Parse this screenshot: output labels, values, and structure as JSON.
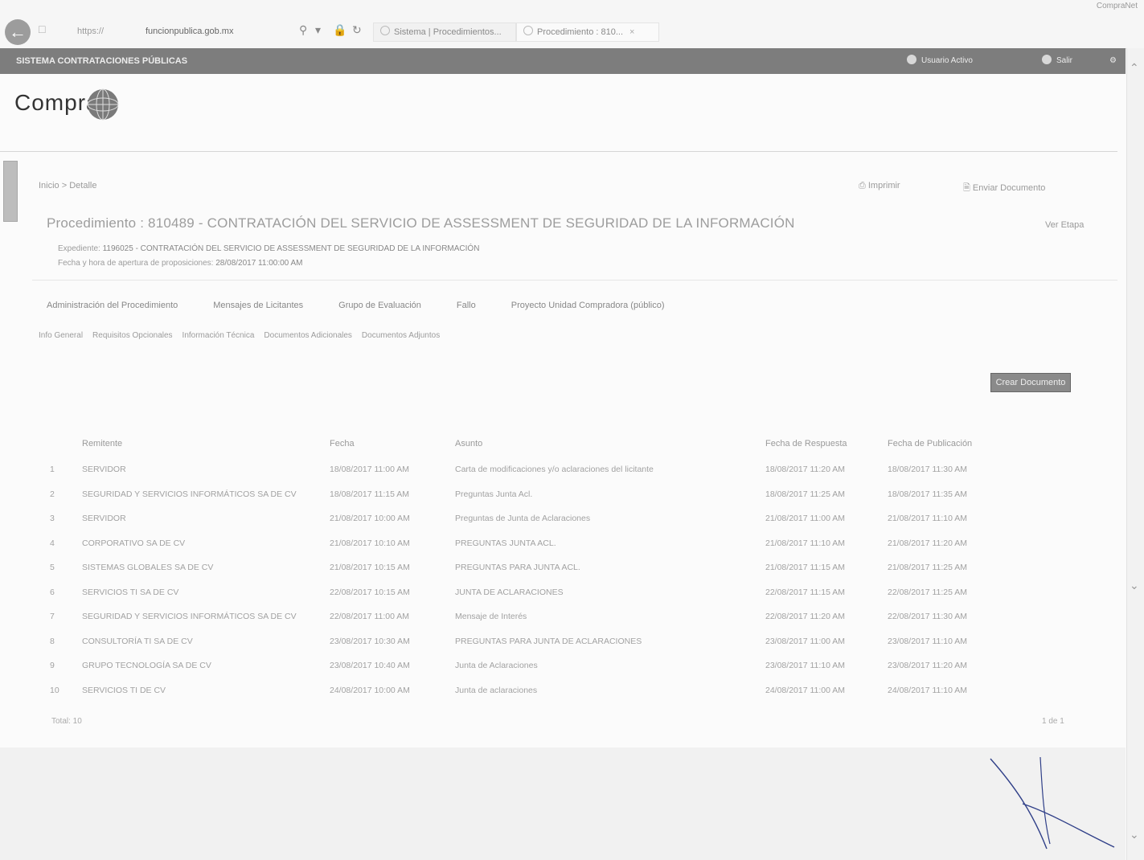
{
  "browser": {
    "address_prefix": "https://",
    "address_domain": "funcionpublica.gob.mx",
    "tabs": [
      {
        "label": "Sistema | Procedimientos..."
      },
      {
        "label": "Procedimiento : 810..."
      }
    ],
    "top_right_text": "CompraNet"
  },
  "appbar": {
    "title": "SISTEMA CONTRATACIONES PÚBLICAS",
    "user_label": "Usuario Activo",
    "menu_label": "Salir"
  },
  "logo": {
    "text": "Compra"
  },
  "breadcrumb": "Inicio > Detalle",
  "header_actions": {
    "action1": "Imprimir",
    "action2": "Enviar Documento"
  },
  "procedure": {
    "title": "Procedimiento : 810489 - CONTRATACIÓN DEL SERVICIO DE ASSESSMENT DE SEGURIDAD DE LA INFORMACIÓN",
    "right_label": "Ver Etapa",
    "expediente_label": "Expediente:",
    "expediente_value": "1196025 - CONTRATACIÓN DEL SERVICIO DE ASSESSMENT DE SEGURIDAD DE LA INFORMACIÓN",
    "fecha_label": "Fecha y hora de apertura de proposiciones:",
    "fecha_value": "28/08/2017 11:00:00 AM"
  },
  "nav_tabs": [
    "Administración del Procedimiento",
    "Mensajes de Licitantes",
    "Grupo de Evaluación",
    "Fallo",
    "Proyecto Unidad Compradora (público)"
  ],
  "sub_tabs": [
    "Info General",
    "Requisitos Opcionales",
    "Información Técnica",
    "Documentos Adicionales",
    "Documentos Adjuntos"
  ],
  "action_button": "Crear Documento",
  "table": {
    "columns": [
      "Remitente",
      "Fecha",
      "Asunto",
      "Fecha de Respuesta",
      "Fecha de Publicación"
    ],
    "rows": [
      {
        "n": "1",
        "from": "SERVIDOR",
        "date": "18/08/2017 11:00 AM",
        "subject": "Carta de modificaciones y/o aclaraciones del licitante",
        "resp": "18/08/2017 11:20 AM",
        "pub": "18/08/2017 11:30 AM"
      },
      {
        "n": "2",
        "from": "SEGURIDAD Y SERVICIOS INFORMÁTICOS SA DE CV",
        "date": "18/08/2017 11:15 AM",
        "subject": "Preguntas Junta Acl.",
        "resp": "18/08/2017 11:25 AM",
        "pub": "18/08/2017 11:35 AM"
      },
      {
        "n": "3",
        "from": "SERVIDOR",
        "date": "21/08/2017 10:00 AM",
        "subject": "Preguntas de Junta de Aclaraciones",
        "resp": "21/08/2017 11:00 AM",
        "pub": "21/08/2017 11:10 AM"
      },
      {
        "n": "4",
        "from": "CORPORATIVO SA DE CV",
        "date": "21/08/2017 10:10 AM",
        "subject": "PREGUNTAS JUNTA ACL.",
        "resp": "21/08/2017 11:10 AM",
        "pub": "21/08/2017 11:20 AM"
      },
      {
        "n": "5",
        "from": "SISTEMAS GLOBALES SA DE CV",
        "date": "21/08/2017 10:15 AM",
        "subject": "PREGUNTAS PARA JUNTA ACL.",
        "resp": "21/08/2017 11:15 AM",
        "pub": "21/08/2017 11:25 AM"
      },
      {
        "n": "6",
        "from": "SERVICIOS TI SA DE CV",
        "date": "22/08/2017 10:15 AM",
        "subject": "JUNTA DE ACLARACIONES",
        "resp": "22/08/2017 11:15 AM",
        "pub": "22/08/2017 11:25 AM"
      },
      {
        "n": "7",
        "from": "SEGURIDAD Y SERVICIOS INFORMÁTICOS SA DE CV",
        "date": "22/08/2017 11:00 AM",
        "subject": "Mensaje de Interés",
        "resp": "22/08/2017 11:20 AM",
        "pub": "22/08/2017 11:30 AM"
      },
      {
        "n": "8",
        "from": "CONSULTORÍA TI SA DE CV",
        "date": "23/08/2017 10:30 AM",
        "subject": "PREGUNTAS PARA JUNTA DE ACLARACIONES",
        "resp": "23/08/2017 11:00 AM",
        "pub": "23/08/2017 11:10 AM"
      },
      {
        "n": "9",
        "from": "GRUPO TECNOLOGÍA SA DE CV",
        "date": "23/08/2017 10:40 AM",
        "subject": "Junta de Aclaraciones",
        "resp": "23/08/2017 11:10 AM",
        "pub": "23/08/2017 11:20 AM"
      },
      {
        "n": "10",
        "from": "SERVICIOS TI DE CV",
        "date": "24/08/2017 10:00 AM",
        "subject": "Junta de aclaraciones",
        "resp": "24/08/2017 11:00 AM",
        "pub": "24/08/2017 11:10 AM"
      }
    ]
  },
  "pager": {
    "left": "Total: 10",
    "right": "1 de 1"
  }
}
